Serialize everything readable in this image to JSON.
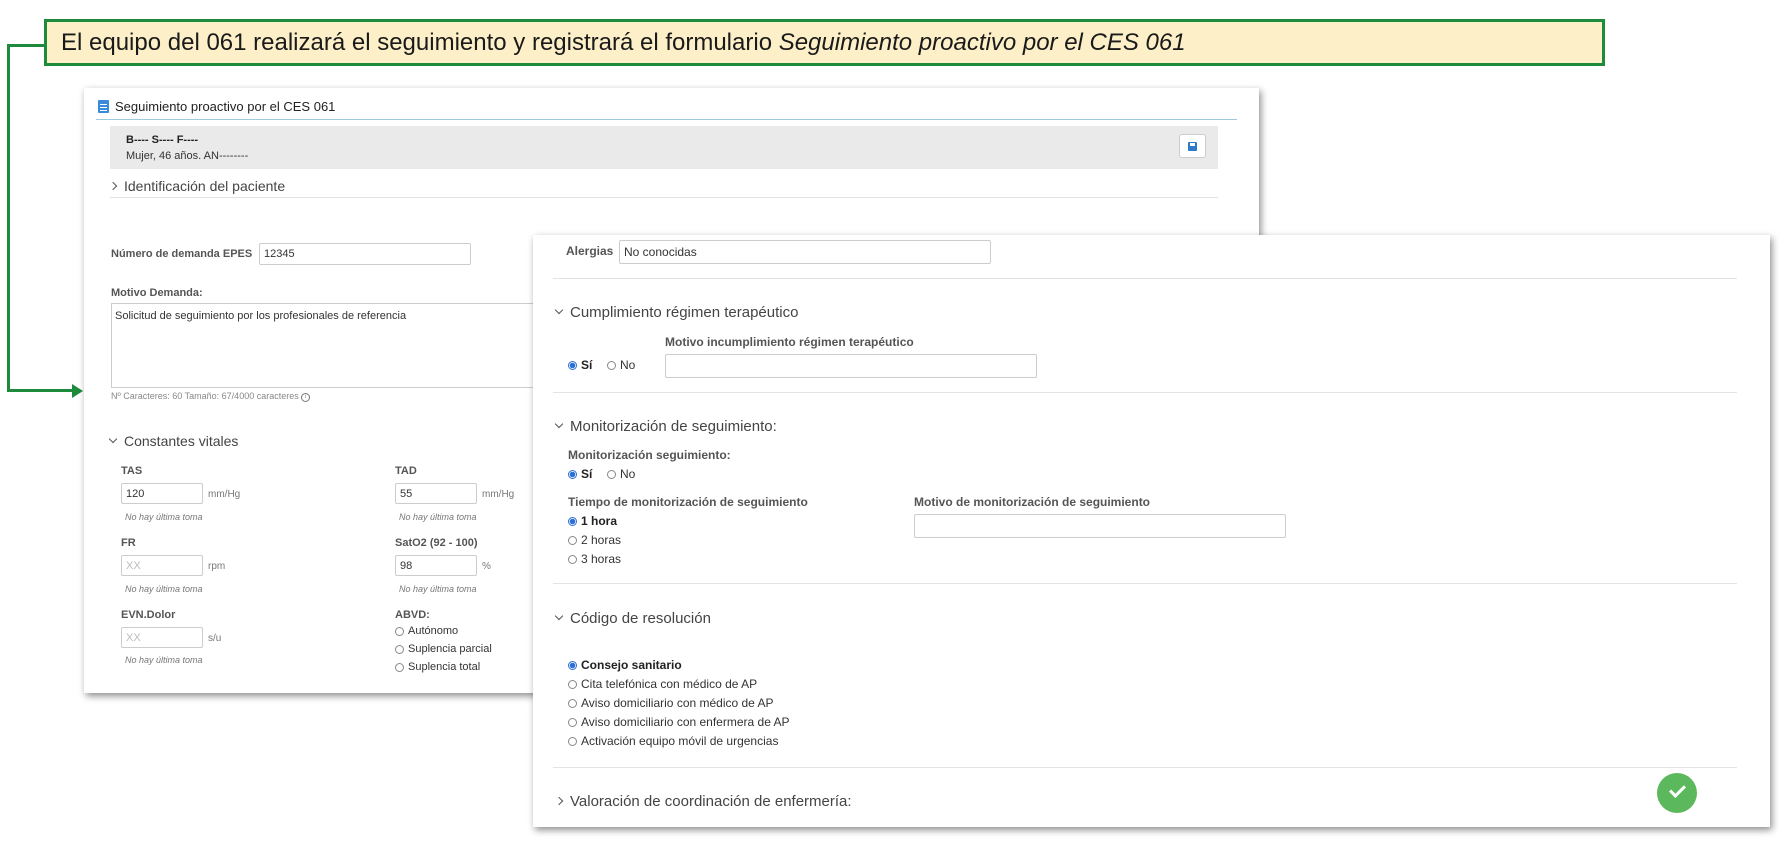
{
  "banner": {
    "text": "El equipo del 061 realizará el seguimiento y registrará el formulario ",
    "italic_text": "Seguimiento proactivo por el CES 061",
    "border_color": "#1e8a3c",
    "background": "#fdf0c8"
  },
  "form1": {
    "title": "Seguimiento proactivo por el CES 061",
    "title_icon": "clipboard-icon",
    "patient": {
      "name": "B---- S---- F----",
      "info": "Mujer, 46 años. AN--------"
    },
    "save_icon": "floppy-disk-icon",
    "section_identification": "Identificación del paciente",
    "epes_label": "Número de demanda EPES",
    "epes_value": "12345",
    "motivo_label": "Motivo Demanda:",
    "motivo_value": "Solicitud de seguimiento por los profesionales de referencia",
    "char_count": "Nº Caracteres: 60 Tamaño: 67/4000 caracteres",
    "section_constantes": "Constantes vitales",
    "vitals": {
      "tas": {
        "label": "TAS",
        "value": "120",
        "unit": "mm/Hg",
        "note": "No hay última toma"
      },
      "tad": {
        "label": "TAD",
        "value": "55",
        "unit": "mm/Hg",
        "note": "No hay última toma"
      },
      "fr": {
        "label": "FR",
        "placeholder": "XX",
        "unit": "rpm",
        "note": "No hay última toma"
      },
      "sato2": {
        "label": "SatO2 (92 - 100)",
        "value": "98",
        "unit": "%",
        "note": "No hay última toma"
      },
      "evn": {
        "label": "EVN.Dolor",
        "placeholder": "XX",
        "unit": "s/u",
        "note": "No hay última toma"
      },
      "abvd": {
        "label": "ABVD:",
        "options": [
          "Autónomo",
          "Suplencia parcial",
          "Suplencia total"
        ]
      }
    }
  },
  "form2": {
    "alergias_label": "Alergias",
    "alergias_value": "No conocidas",
    "section_cumplimiento": "Cumplimiento régimen terapéutico",
    "cumplimiento": {
      "yes": "Sí",
      "no": "No",
      "selected": "yes"
    },
    "motivo_incumplimiento_label": "Motivo incumplimiento régimen terapéutico",
    "section_monitorizacion": "Monitorización de seguimiento:",
    "monitorizacion_label": "Monitorización seguimiento:",
    "monitorizacion": {
      "yes": "Sí",
      "no": "No",
      "selected": "yes"
    },
    "tiempo_label": "Tiempo de monitorización de seguimiento",
    "tiempo_options": [
      "1 hora",
      "2 horas",
      "3 horas"
    ],
    "tiempo_selected": "1 hora",
    "motivo_monitorizacion_label": "Motivo de monitorización de seguimiento",
    "section_resolucion": "Código de resolución",
    "resolucion_options": [
      "Consejo sanitario",
      "Cita telefónica con médico de AP",
      "Aviso domiciliario con médico de AP",
      "Aviso domiciliario con enfermera de AP",
      "Activación equipo móvil de urgencias"
    ],
    "resolucion_selected": "Consejo sanitario",
    "section_valoracion": "Valoración de coordinación de enfermería:",
    "confirm_icon": "check-icon",
    "confirm_color": "#5cb85c"
  }
}
